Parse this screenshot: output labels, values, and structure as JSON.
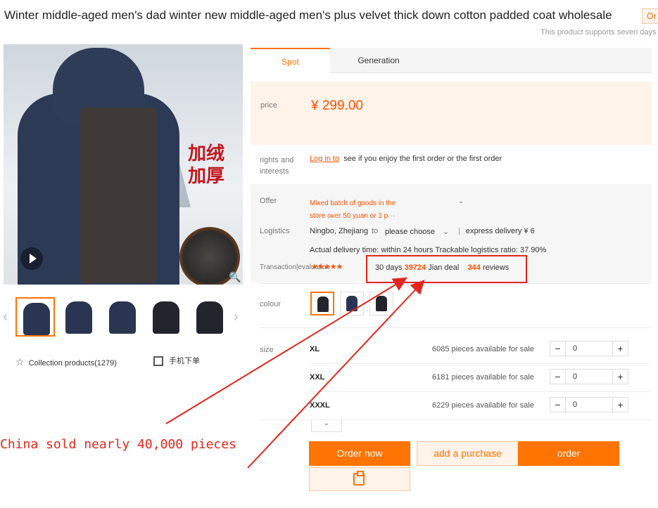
{
  "product": {
    "title": "Winter middle-aged men's dad winter new middle-aged men's plus velvet thick down cotton padded coat wholesale",
    "title_badge": "Or",
    "support_note": "This product supports seven days w",
    "promo_text": "加绒加厚",
    "collect_label": "Collection products(1279)",
    "mobile_order_label": "手机下单"
  },
  "tabs": [
    {
      "label": "Spot",
      "active": true
    },
    {
      "label": "Generation",
      "active": false
    }
  ],
  "price": {
    "label": "price",
    "value": "¥  299.00"
  },
  "rights": {
    "label": "rights and interests",
    "link": "Log in to",
    "text": "see if you enjoy the first order or the first order"
  },
  "offer": {
    "label": "Offer",
    "line1": "Mixed batch  of goods  in the",
    "line2": "store over 50 yuan or 1 p···"
  },
  "logistics": {
    "label": "Logistics",
    "origin": "Ningbo, Zhejiang",
    "to": "to",
    "destination": "please choose",
    "express": "express delivery ¥ 6",
    "delivery_time": "Actual delivery time:  within 24 hours   Trackable logistics ratio:  37.90%"
  },
  "transaction": {
    "label": "Transaction|evaluation",
    "stars": "★★★★★",
    "days_label": "30 days",
    "sold": "39724",
    "deal_label": "Jian deal",
    "reviews_count": "344",
    "reviews_label": "reviews"
  },
  "colour": {
    "label": "colour",
    "options_count": 3
  },
  "sizes": {
    "label": "size",
    "rows": [
      {
        "name": "XL",
        "stock": "6085  pieces available for sale",
        "qty": "0"
      },
      {
        "name": "XXL",
        "stock": "6181  pieces available for sale",
        "qty": "0"
      },
      {
        "name": "XXXL",
        "stock": "6229  pieces available for sale",
        "qty": "0"
      }
    ],
    "minus": "−",
    "plus": "+"
  },
  "annotation": "China sold nearly 40,000 pieces",
  "buttons": {
    "order_now": "Order now",
    "add_purchase": "add a purchase",
    "order": "order"
  },
  "colors": {
    "accent": "#ff7300",
    "price_red": "#ff5000",
    "annotation_red": "#e2261c"
  }
}
